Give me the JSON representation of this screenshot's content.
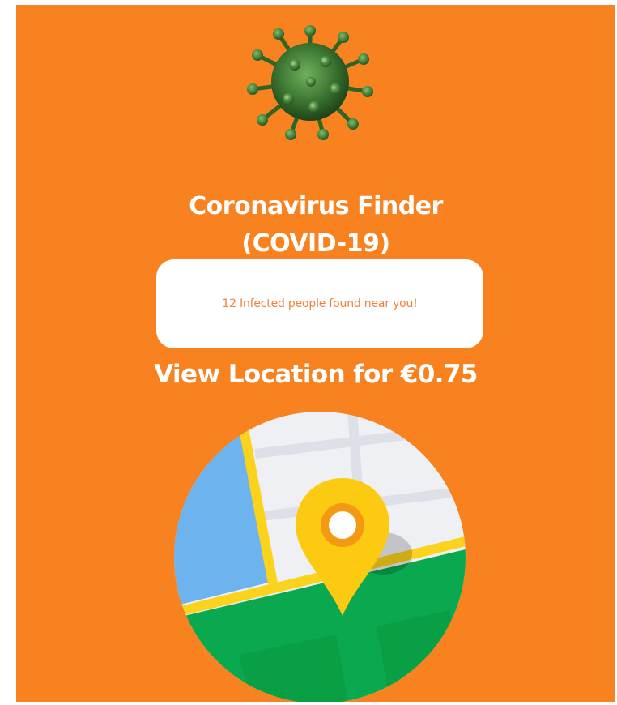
{
  "app": {
    "title_line1": "Coronavirus Finder",
    "title_line2": "(COVID-19)"
  },
  "card": {
    "message": "12 Infected people found near you!"
  },
  "cta": {
    "label": "View Location for €0.75"
  },
  "colors": {
    "background": "#f7821f",
    "card_background": "#ffffff",
    "card_text": "#f0833a",
    "map_water": "#6db3ee",
    "map_grass": "#0aa84f",
    "map_road": "#fbd21c",
    "map_land": "#eef0f4",
    "pin": "#fccb11"
  },
  "icons": {
    "header": "virus-icon",
    "map": "map-location-icon",
    "pin": "map-pin-icon"
  }
}
